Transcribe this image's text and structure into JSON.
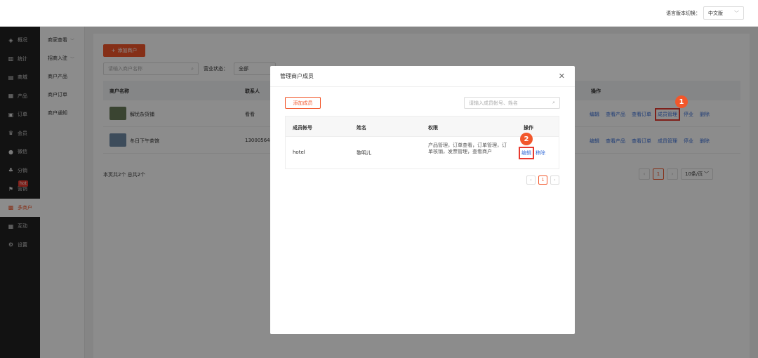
{
  "topbar": {
    "lang_label": "语言版本切换：",
    "lang_value": "中文版"
  },
  "sidebar": {
    "items": [
      {
        "icon": "layers-icon",
        "glyph": "◈",
        "label": "概况"
      },
      {
        "icon": "chart-icon",
        "glyph": "▥",
        "label": "统计"
      },
      {
        "icon": "store-icon",
        "glyph": "▤",
        "label": "商城"
      },
      {
        "icon": "grid-icon",
        "glyph": "▦",
        "label": "产品"
      },
      {
        "icon": "order-icon",
        "glyph": "▣",
        "label": "订单"
      },
      {
        "icon": "crown-icon",
        "glyph": "♛",
        "label": "会员"
      },
      {
        "icon": "wechat-icon",
        "glyph": "●",
        "label": "微信"
      },
      {
        "icon": "share-icon",
        "glyph": "♣",
        "label": "分销"
      },
      {
        "icon": "flag-icon",
        "glyph": "⚑",
        "label": "营销",
        "badge": "hot"
      },
      {
        "icon": "multi-store-icon",
        "glyph": "▩",
        "label": "多商户"
      },
      {
        "icon": "interact-icon",
        "glyph": "▦",
        "label": "互动"
      },
      {
        "icon": "gear-icon",
        "glyph": "⚙",
        "label": "设置"
      }
    ]
  },
  "subnav": {
    "items": [
      {
        "label": "商家查看",
        "chevron": true
      },
      {
        "label": "招商入驻",
        "chevron": true
      },
      {
        "label": "商户产品",
        "chevron": false
      },
      {
        "label": "商户订单",
        "chevron": false
      },
      {
        "label": "商户通知",
        "chevron": false
      }
    ]
  },
  "main": {
    "add_button": "添加商户",
    "search_placeholder": "请输入商户名称",
    "status_label": "营业状态：",
    "status_value": "全部",
    "columns": {
      "name": "商户名称",
      "contact": "联系人",
      "ops": "操作"
    },
    "rows": [
      {
        "name": "解忧杂货铺",
        "contact": "看看",
        "thumb_color": "#6b7d5a",
        "ops": [
          "编辑",
          "查看产品",
          "查看订单",
          "成员管理",
          "停业",
          "删除"
        ]
      },
      {
        "name": "冬日下午茶馆",
        "contact": "13000564",
        "thumb_color": "#6f8aa6",
        "ops": [
          "编辑",
          "查看产品",
          "查看订单",
          "成员管理",
          "停业",
          "删除"
        ]
      }
    ],
    "footer": "本页共2个 总共2个",
    "page_current": "1",
    "per_page": "10条/页"
  },
  "modal": {
    "title": "管理商户成员",
    "add_member": "添加成员",
    "search_placeholder": "请输入成员帐号、姓名",
    "columns": {
      "account": "成员帐号",
      "name": "姓名",
      "perms": "权限",
      "ops": "操作"
    },
    "row": {
      "account": "hotel",
      "name": "黎明儿",
      "perms": "产品管理，订单查看，订单管理，订单核销，发票管理，查看商户",
      "edit": "编辑",
      "remove": "移除"
    },
    "page_current": "1"
  },
  "steps": {
    "step1": "1",
    "step2": "2"
  },
  "colors": {
    "accent": "#f2572b",
    "link": "#3a6fd8",
    "highlight": "#e8392f",
    "sidebar_bg": "#222222"
  }
}
